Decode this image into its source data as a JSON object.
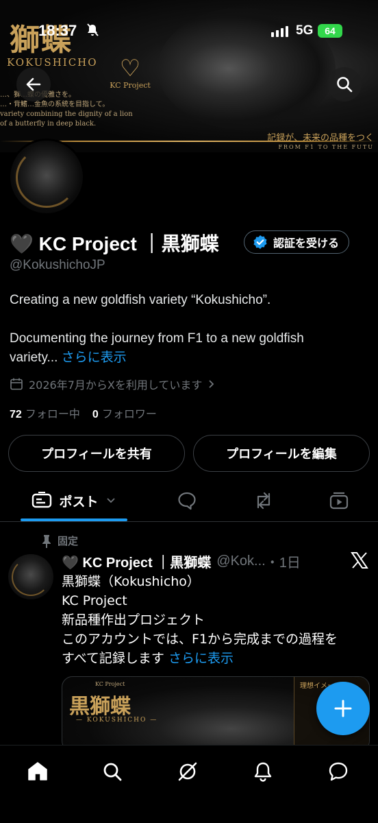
{
  "status_bar": {
    "time": "18:37",
    "network": "5G",
    "battery": "64"
  },
  "banner": {
    "title_kanji": "獅蝶",
    "romaji": "KOKUSHICHO",
    "logo_text": "KC Project",
    "line1": "…、獅…蝶の優雅さを。",
    "line2": "…・背鰭…金魚の系統を目指して。",
    "line3": "variety combining the dignity of a lion",
    "line4": "of a butterfly in deep black.",
    "tagline": "記録が、未来の品種をつく",
    "tagline2": "FROM F1 TO THE FUTU"
  },
  "profile": {
    "display_name": "🖤 KC Project ｜黒獅蝶",
    "verify_button": "認証を受ける",
    "handle": "@KokushichoJP",
    "bio_line1": "Creating a new goldfish variety “Kokushicho”.",
    "bio_line2": "Documenting the journey from F1 to a new goldfish variety...",
    "bio_more": "さらに表示",
    "joined": "2026年7月からXを利用しています",
    "following_count": "72",
    "following_label": "フォロー中",
    "followers_count": "0",
    "followers_label": "フォロワー",
    "share_button": "プロフィールを共有",
    "edit_button": "プロフィールを編集"
  },
  "tabs": {
    "posts_label": "ポスト"
  },
  "pinned_post": {
    "pinned_label": "固定",
    "author_name": "🖤 KC Project ｜黒獅蝶",
    "author_handle": "@Kok...",
    "time": "・1日",
    "lines": [
      "黒獅蝶（Kokushicho）",
      "KC Project",
      "新品種作出プロジェクト",
      "このアカウントでは、F1から完成までの過程を",
      "すべて記録します"
    ],
    "more": "さらに表示",
    "media": {
      "top": "KC Project",
      "title": "黒獅蝶",
      "subtitle": "— KOKUSHICHO —",
      "box_title": "理想イメージ"
    }
  },
  "colors": {
    "accent": "#1d9bf0",
    "background": "#000000",
    "muted": "#71767b",
    "gold": "#c9a15a"
  }
}
